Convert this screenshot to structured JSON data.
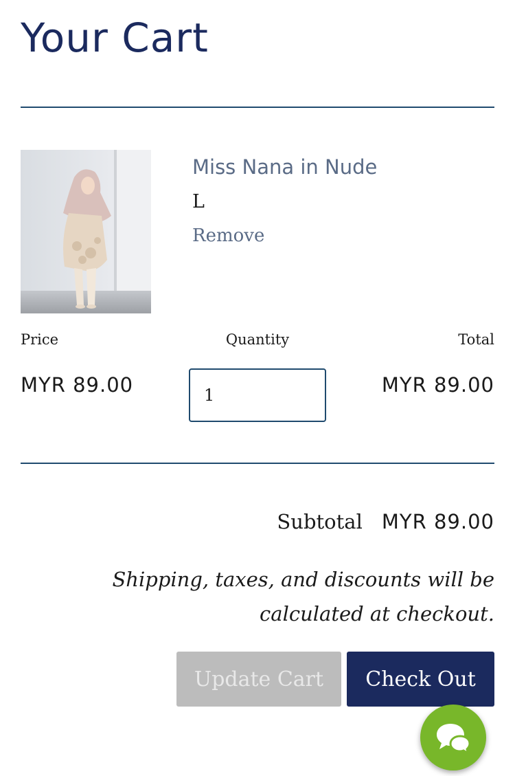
{
  "page": {
    "title": "Your Cart"
  },
  "item": {
    "name": "Miss Nana in Nude",
    "variant": "L",
    "remove_label": "Remove",
    "image_alt": "Miss Nana in Nude"
  },
  "columns": {
    "price": "Price",
    "quantity": "Quantity",
    "total": "Total"
  },
  "line": {
    "price": "MYR 89.00",
    "quantity": "1",
    "total": "MYR 89.00"
  },
  "summary": {
    "subtotal_label": "Subtotal",
    "subtotal_value": "MYR 89.00",
    "shipping_note": "Shipping, taxes, and discounts will be calculated at checkout."
  },
  "actions": {
    "update_label": "Update Cart",
    "checkout_label": "Check Out"
  },
  "colors": {
    "brand_navy": "#1b2a5e",
    "divider": "#1f4a6e",
    "link": "#5a6b86",
    "update_disabled": "#bcbcbc",
    "chat_green": "#78b72a"
  },
  "icons": {
    "chat": "chat-bubbles-icon"
  }
}
